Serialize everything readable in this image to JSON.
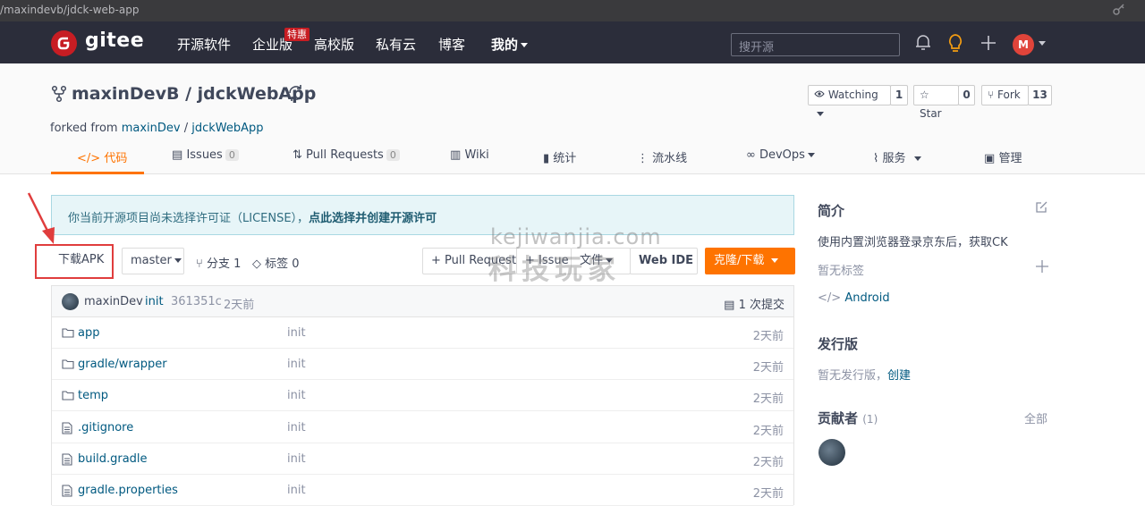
{
  "browser": {
    "url_fragment": "/maxindevb/jdck-web-app",
    "key_icon": "key-icon"
  },
  "topnav": {
    "logo_text": "gitee",
    "items": [
      "开源软件",
      "企业版",
      "高校版",
      "私有云",
      "博客",
      "我的"
    ],
    "special_tag": "特惠",
    "search_placeholder": "搜开源",
    "avatar_letter": "M",
    "icons": [
      "bell-icon",
      "bulb-icon",
      "plus-icon"
    ],
    "bg_color": "#2b2d3a",
    "brand_color": "#c71d23"
  },
  "repo": {
    "owner": "maxinDevB",
    "separator": "/",
    "name": "jdckWebApp",
    "forked_prefix": "forked from",
    "forked_owner": "maxinDev",
    "forked_repo": "jdckWebApp",
    "watching_label": "Watching",
    "watching_count": "1",
    "star_label": "Star",
    "star_count": "0",
    "fork_label": "Fork",
    "fork_count": "13"
  },
  "tabs": [
    {
      "label": "代码",
      "icon": "</>"
    },
    {
      "label": "Issues",
      "count": "0"
    },
    {
      "label": "Pull Requests",
      "count": "0"
    },
    {
      "label": "Wiki"
    },
    {
      "label": "统计"
    },
    {
      "label": "流水线"
    },
    {
      "label": "DevOps"
    },
    {
      "label": "服务"
    },
    {
      "label": "管理"
    }
  ],
  "notice": {
    "text": "你当前开源项目尚未选择许可证（LICENSE），",
    "link": "点此选择并创建开源许可"
  },
  "toolbar": {
    "download_apk": "下载APK",
    "branch": "master",
    "branches_label": "分支 1",
    "tags_label": "标签 0",
    "pull_request": "+ Pull Request",
    "issue": "+ Issue",
    "file_menu": "文件",
    "web_ide": "Web IDE",
    "clone": "克隆/下载",
    "accent_color": "#fe7300"
  },
  "commit": {
    "author": "maxinDev",
    "message": "init",
    "hash": "361351c",
    "time": "2天前",
    "commits_label": "1 次提交"
  },
  "files": [
    {
      "name": "app",
      "type": "folder",
      "message": "init",
      "time": "2天前"
    },
    {
      "name": "gradle/wrapper",
      "type": "folder",
      "message": "init",
      "time": "2天前"
    },
    {
      "name": "temp",
      "type": "folder",
      "message": "init",
      "time": "2天前"
    },
    {
      "name": ".gitignore",
      "type": "file",
      "message": "init",
      "time": "2天前"
    },
    {
      "name": "build.gradle",
      "type": "file",
      "message": "init",
      "time": "2天前"
    },
    {
      "name": "gradle.properties",
      "type": "file",
      "message": "init",
      "time": "2天前"
    }
  ],
  "sidebar": {
    "intro_title": "简介",
    "intro_text": "使用内置浏览器登录京东后，获取CK",
    "no_tags": "暂无标签",
    "language": "Android",
    "releases_title": "发行版",
    "no_releases": "暂无发行版，",
    "create_link": "创建",
    "contributors_title": "贡献者",
    "contributors_count": "(1)",
    "all_link": "全部"
  },
  "watermark": {
    "line1": "kejiwanjia.com",
    "line2": "科技玩家"
  }
}
